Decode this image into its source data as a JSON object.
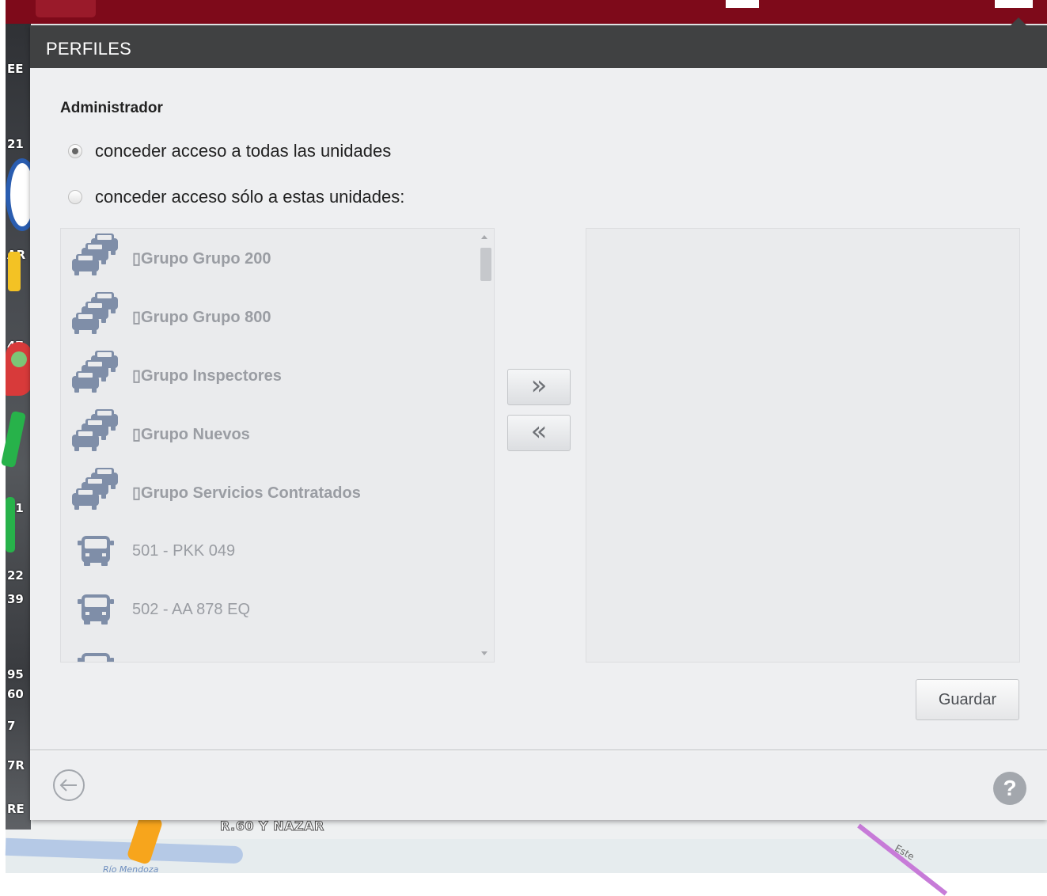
{
  "dialog": {
    "title": "PERFILES",
    "section_title": "Administrador",
    "radio_all": {
      "label": "conceder acceso a todas las unidades",
      "checked": true
    },
    "radio_some": {
      "label": "conceder acceso sólo a estas unidades:",
      "checked": false
    },
    "available_units": [
      {
        "type": "group",
        "label": "Grupo Grupo 200",
        "icon": "car-group-icon"
      },
      {
        "type": "group",
        "label": "Grupo Grupo 800",
        "icon": "car-group-icon"
      },
      {
        "type": "group",
        "label": "Grupo Inspectores",
        "icon": "car-group-icon"
      },
      {
        "type": "group",
        "label": "Grupo Nuevos",
        "icon": "car-group-icon"
      },
      {
        "type": "group",
        "label": "Grupo Servicios Contratados",
        "icon": "car-group-icon"
      },
      {
        "type": "unit",
        "label": "501 - PKK 049",
        "icon": "bus-icon"
      },
      {
        "type": "unit",
        "label": "502 - AA 878 EQ",
        "icon": "bus-icon"
      },
      {
        "type": "unit",
        "label": "",
        "icon": "bus-icon"
      }
    ],
    "selected_units": [],
    "add_button": "»",
    "remove_button": "«",
    "save_button": "Guardar",
    "help_label": "?"
  },
  "map": {
    "road_label": "R.60 Y NAZAR",
    "river_label": "Río Mendoza",
    "street_label": "Este"
  },
  "colors": {
    "topbar": "#7e0a1a",
    "header": "#404142",
    "icon_blue": "#7f8ea8"
  }
}
